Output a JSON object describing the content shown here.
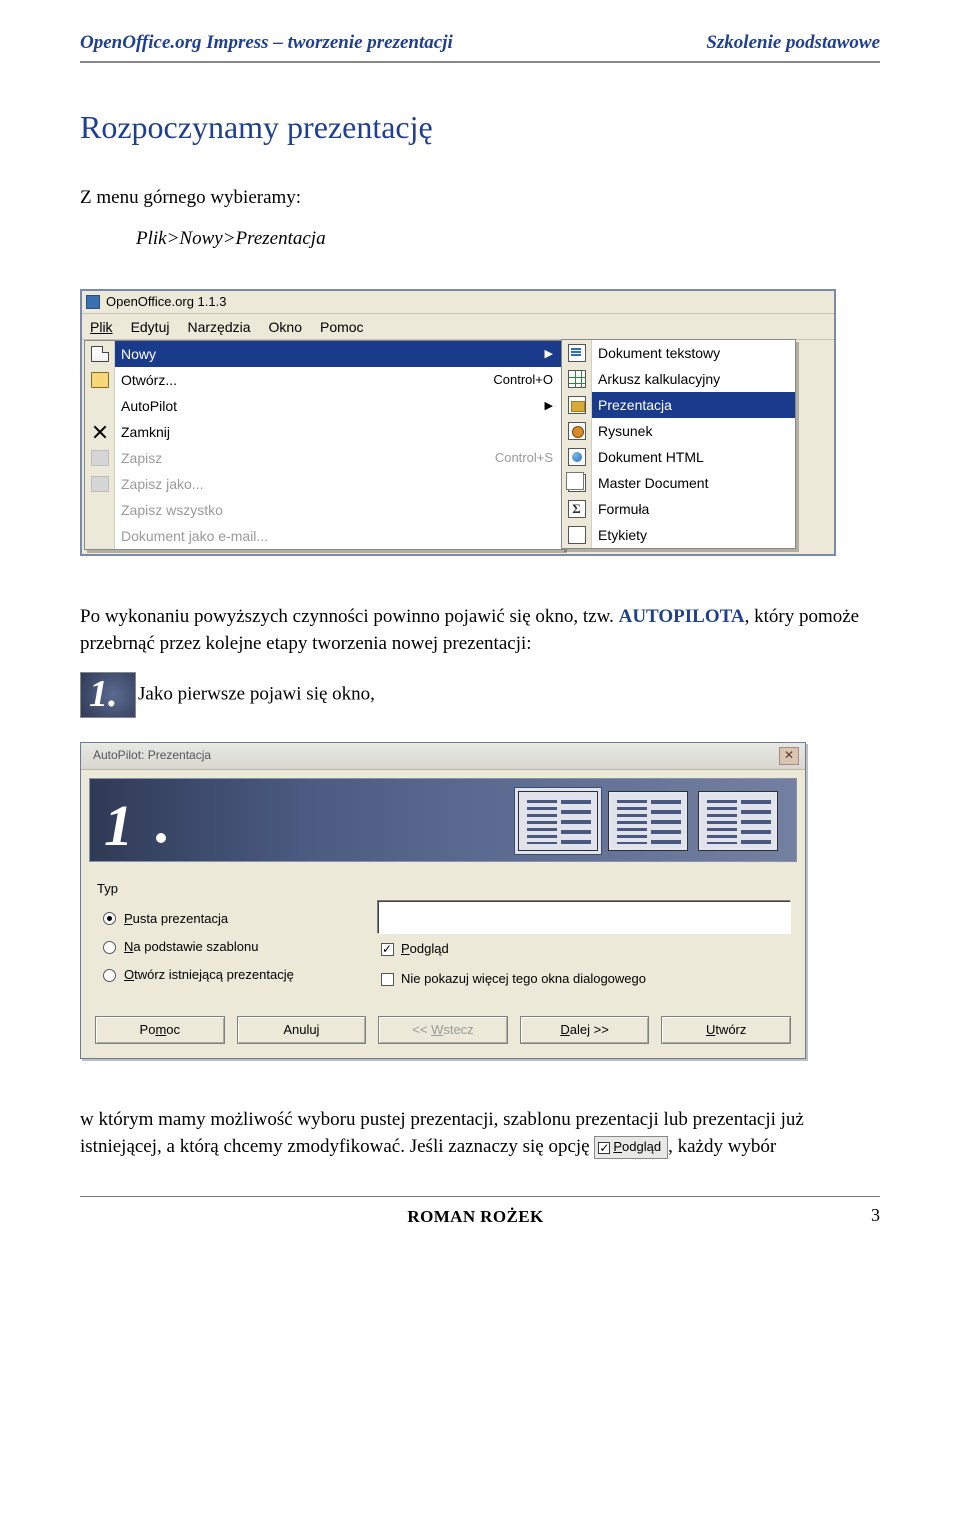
{
  "header": {
    "left": "OpenOffice.org Impress – tworzenie prezentacji",
    "right": "Szkolenie podstawowe"
  },
  "section_title": "Rozpoczynamy prezentację",
  "intro_line": "Z menu górnego wybieramy:",
  "menu_path": "Plik>Nowy>Prezentacja",
  "screenshot1": {
    "app_title": "OpenOffice.org 1.1.3",
    "menubar": {
      "file": "Plik",
      "edit": "Edytuj",
      "tools": "Narzędzia",
      "window": "Okno",
      "help": "Pomoc"
    },
    "file_menu": {
      "new": "Nowy",
      "open": "Otwórz...",
      "open_shortcut": "Control+O",
      "autopilot": "AutoPilot",
      "close": "Zamknij",
      "save": "Zapisz",
      "save_shortcut": "Control+S",
      "save_as": "Zapisz jako...",
      "save_all": "Zapisz wszystko",
      "doc_as_email": "Dokument jako e-mail..."
    },
    "new_submenu": {
      "text": "Dokument tekstowy",
      "sheet": "Arkusz kalkulacyjny",
      "presentation": "Prezentacja",
      "drawing": "Rysunek",
      "html": "Dokument HTML",
      "master": "Master Document",
      "formula": "Formuła",
      "labels": "Etykiety"
    }
  },
  "para_after_shot1_a": "Po wykonaniu powyższych czynności powinno pojawić się okno, tzw. ",
  "para_after_shot1_auto": "AUTOPILOTA",
  "para_after_shot1_b": ", który pomoże przebrnąć przez kolejne etapy tworzenia nowej prezentacji:",
  "step_badge_text": "Jako pierwsze pojawi się okno,",
  "dialog": {
    "title": "AutoPilot: Prezentacja",
    "group_label": "Typ",
    "radios": {
      "empty": "Pusta prezentacja",
      "from_template": "Na podstawie szablonu",
      "open_existing": "Otwórz istniejącą prezentację"
    },
    "preview_check": "Podgląd",
    "dont_show": "Nie pokazuj więcej tego okna dialogowego",
    "buttons": {
      "help": "Pomoc",
      "cancel": "Anuluj",
      "back": "<< Wstecz",
      "next": "Dalej >>",
      "create": "Utwórz"
    }
  },
  "para_last_a": " w którym mamy możliwość wyboru pustej prezentacji, szablonu prezentacji lub prezentacji już istniejącej, a którą chcemy zmodyfikować. Jeśli zaznaczy się opcję ",
  "para_last_inline": "Podgląd",
  "para_last_b": ", każdy wybór",
  "footer": {
    "author": "ROMAN ROŻEK",
    "page": "3"
  }
}
